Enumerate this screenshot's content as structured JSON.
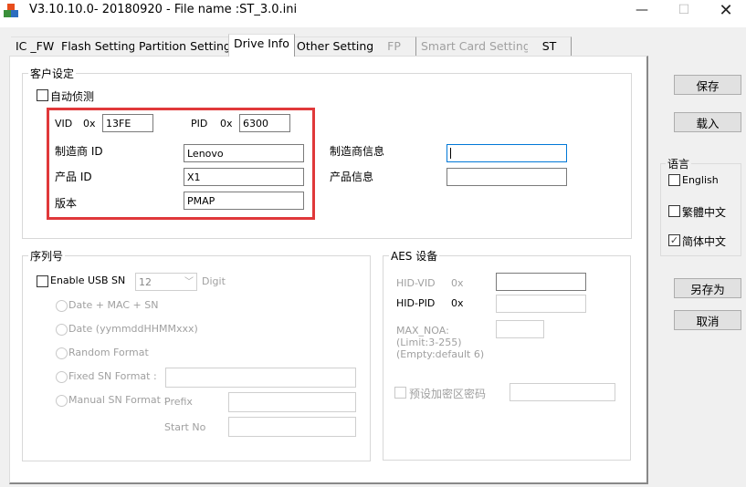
{
  "window": {
    "title": "V3.10.10.0- 20180920 - File name :ST_3.0.ini",
    "controls": {
      "minimize": "—",
      "maximize": "☐",
      "close": "✕"
    }
  },
  "tabs": [
    {
      "label": "IC _FW",
      "state": "normal"
    },
    {
      "label": "Flash Setting",
      "state": "normal"
    },
    {
      "label": "Partition Setting",
      "state": "normal"
    },
    {
      "label": "Drive Info",
      "state": "active"
    },
    {
      "label": "Other Setting",
      "state": "normal"
    },
    {
      "label": "FP",
      "state": "disabled"
    },
    {
      "label": "Smart Card Setting",
      "state": "disabled"
    },
    {
      "label": "ST",
      "state": "normal"
    }
  ],
  "customer": {
    "legend": "客户设定",
    "auto_detect": {
      "label": "自动侦测",
      "checked": false
    },
    "vid": {
      "label": "VID",
      "prefix": "0x",
      "value": "13FE"
    },
    "pid": {
      "label": "PID",
      "prefix": "0x",
      "value": "6300"
    },
    "vendor_id": {
      "label": "制造商 ID",
      "value": "Lenovo"
    },
    "product_id": {
      "label": "产品 ID",
      "value": "X1"
    },
    "version": {
      "label": "版本",
      "value": "PMAP"
    },
    "vendor_info": {
      "label": "制造商信息",
      "value": ""
    },
    "product_info": {
      "label": "产品信息",
      "value": ""
    },
    "highlight_color": "#e0383a"
  },
  "serial": {
    "legend": "序列号",
    "enable_usb_sn": {
      "label": "Enable USB SN",
      "checked": false
    },
    "digits": {
      "value": "12",
      "unit": "Digit"
    },
    "options": [
      {
        "label": "Date + MAC + SN"
      },
      {
        "label": "Date (yymmddHHMMxxx)"
      },
      {
        "label": "Random Format"
      },
      {
        "label": "Fixed SN Format :"
      },
      {
        "label": "Manual SN Format :"
      }
    ],
    "fixed_value": "",
    "prefix": {
      "label": "Prefix",
      "value": ""
    },
    "start_no": {
      "label": "Start No",
      "value": ""
    }
  },
  "aes": {
    "legend": "AES 设备",
    "hid_vid": {
      "label": "HID-VID",
      "prefix": "0x",
      "value": ""
    },
    "hid_pid": {
      "label": "HID-PID",
      "prefix": "0x",
      "value": ""
    },
    "max_noa": {
      "label": "MAX_NOA:",
      "limit": "(Limit:3-255)",
      "empty": "(Empty:default 6)",
      "value": ""
    },
    "preset_password": {
      "label": "预设加密区密码",
      "checked": false,
      "value": ""
    }
  },
  "side": {
    "save": "保存",
    "load": "载入",
    "language": {
      "legend": "语言",
      "options": [
        {
          "label": "English",
          "checked": false
        },
        {
          "label": "繁體中文",
          "checked": false
        },
        {
          "label": "简体中文",
          "checked": true
        }
      ]
    },
    "save_as": "另存为",
    "cancel": "取消"
  }
}
